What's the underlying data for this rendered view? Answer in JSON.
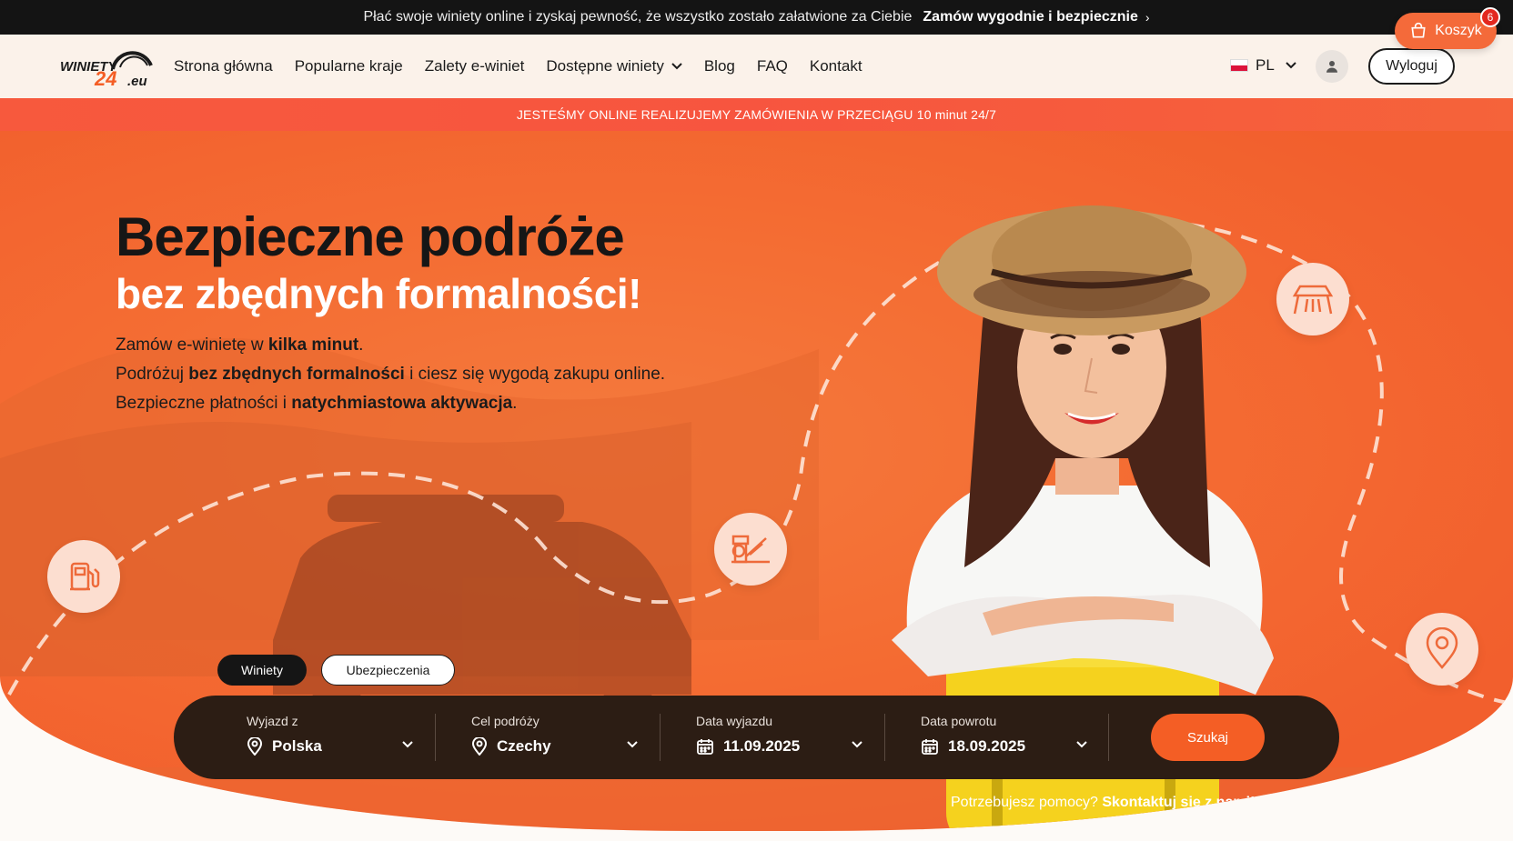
{
  "topbar": {
    "message": "Płać swoje winiety online i zyskaj pewność, że wszystko zostało załatwione za Ciebie",
    "link": "Zamów wygodnie i bezpiecznie",
    "link_chevron": "›"
  },
  "cart": {
    "label": "Koszyk",
    "count": "6"
  },
  "logo": {
    "line1": "WINIETY",
    "line2": "24",
    "suffix": ".eu"
  },
  "nav": {
    "items": [
      {
        "label": "Strona główna"
      },
      {
        "label": "Popularne kraje"
      },
      {
        "label": "Zalety e-winiet"
      },
      {
        "label": "Dostępne winiety",
        "has_dropdown": true
      },
      {
        "label": "Blog"
      },
      {
        "label": "FAQ"
      },
      {
        "label": "Kontakt"
      }
    ],
    "language": "PL",
    "logout": "Wyloguj"
  },
  "announcement": "JESTEŚMY ONLINE REALIZUJEMY ZAMÓWIENIA W PRZECIĄGU 10 minut 24/7",
  "hero": {
    "title": "Bezpieczne podróże",
    "subtitle": "bez zbędnych formalności!",
    "line1_pre": "Zamów e-winietę w ",
    "line1_bold": "kilka minut",
    "line1_post": ".",
    "line2_pre": "Podróżuj ",
    "line2_bold": "bez zbędnych formalności",
    "line2_post": " i ciesz się wygodą zakupu online.",
    "line3_pre": "Bezpieczne płatności i ",
    "line3_bold": "natychmiastowa aktywacja",
    "line3_post": "."
  },
  "tabs": [
    {
      "label": "Winiety",
      "active": true
    },
    {
      "label": "Ubezpieczenia",
      "active": false
    }
  ],
  "search": {
    "from_label": "Wyjazd z",
    "from_value": "Polska",
    "to_label": "Cel podróży",
    "to_value": "Czechy",
    "depart_label": "Data wyjazdu",
    "depart_value": "11.09.2025",
    "return_label": "Data powrotu",
    "return_value": "18.09.2025",
    "submit": "Szukaj"
  },
  "help": {
    "question": "Potrzebujesz pomocy?",
    "link": "Skontaktuj się z nami!",
    "chevron": "›"
  },
  "colors": {
    "accent": "#f45e25",
    "dark": "#2c1d14",
    "hero": "#f46d33"
  },
  "icons": [
    "shopping-bag-icon",
    "chevron-down-icon",
    "user-icon",
    "fuel-pump-icon",
    "toll-gate-icon",
    "road-icon",
    "map-pin-icon",
    "calendar-icon"
  ]
}
